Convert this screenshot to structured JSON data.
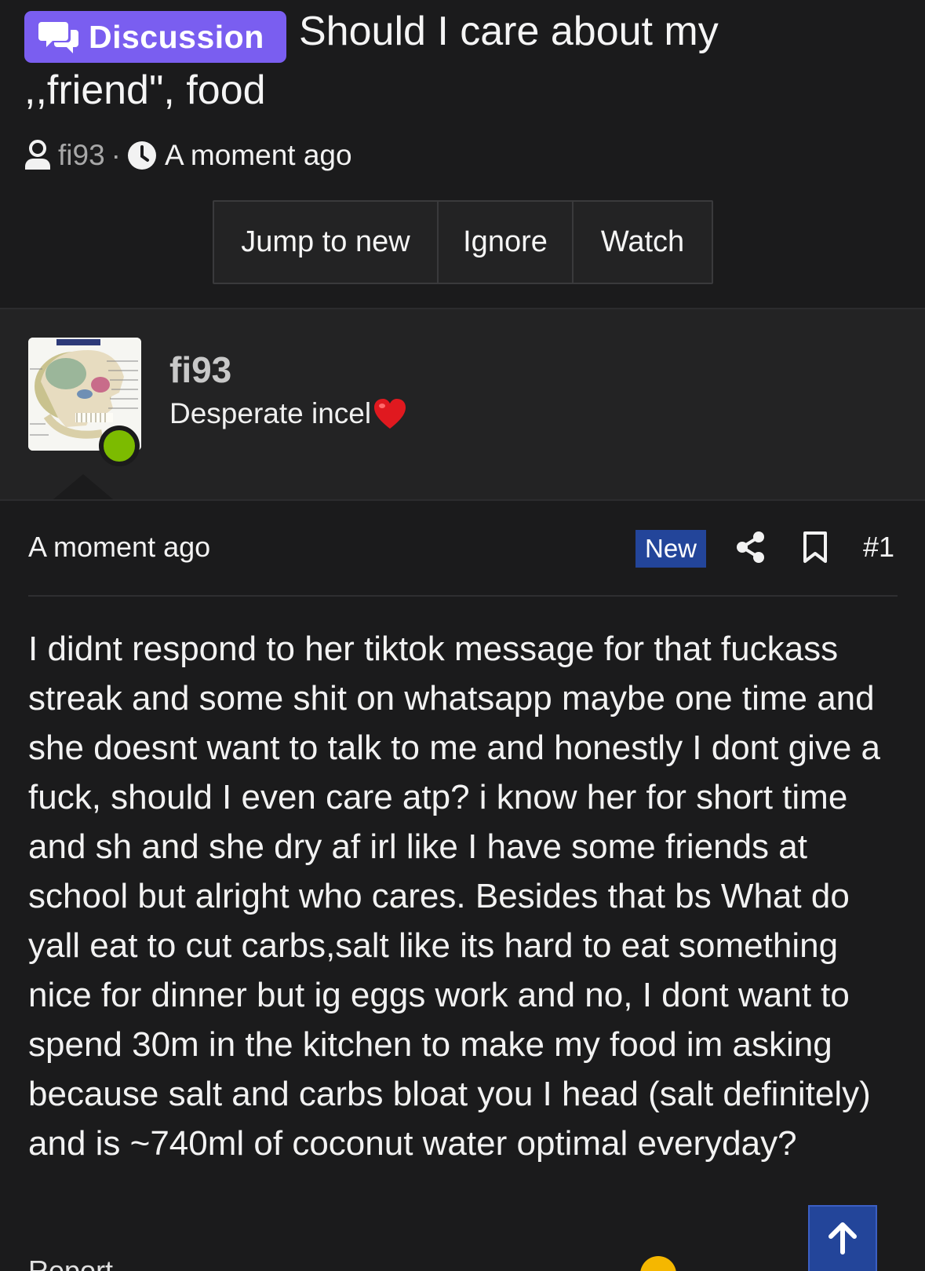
{
  "thread": {
    "prefix_label": "Discussion",
    "title_line1": "Should I care about my",
    "title_line2": ",,friend\", food",
    "author": "fi93",
    "separator": "·",
    "time": "A moment ago"
  },
  "actions": {
    "jump_label": "Jump to new",
    "ignore_label": "Ignore",
    "watch_label": "Watch"
  },
  "user": {
    "name": "fi93",
    "title": "Desperate incel",
    "status_color": "#7cbb00"
  },
  "post": {
    "time": "A moment ago",
    "new_badge": "New",
    "number": "#1",
    "body": "I didnt respond to her tiktok message for that fuckass streak and some shit on whatsapp maybe one time and she doesnt want to talk to me and honestly I dont give a fuck, should I even care atp? i know her for short time and sh and she dry af irl like I have some friends at school but alright who cares. Besides that bs What do yall eat to cut carbs,salt like its hard to eat something nice for dinner but ig eggs work and no, I dont want to spend 30m in the kitchen to make my food im asking because salt and carbs bloat you I head (salt definitely) and is ~740ml of coconut water optimal everyday?"
  },
  "footer": {
    "report_partial": "Report"
  },
  "colors": {
    "background": "#1b1b1c",
    "panel": "#232324",
    "prefix_accent": "#7a5ef0",
    "new_badge": "#23459a",
    "heart": "#e0191f"
  },
  "icons": {
    "prefix": "chat-bubbles-icon",
    "author": "user-icon",
    "time": "clock-icon",
    "title_emoji": "red-heart-icon",
    "share": "share-icon",
    "bookmark": "bookmark-icon",
    "scroll": "arrow-up-icon"
  }
}
